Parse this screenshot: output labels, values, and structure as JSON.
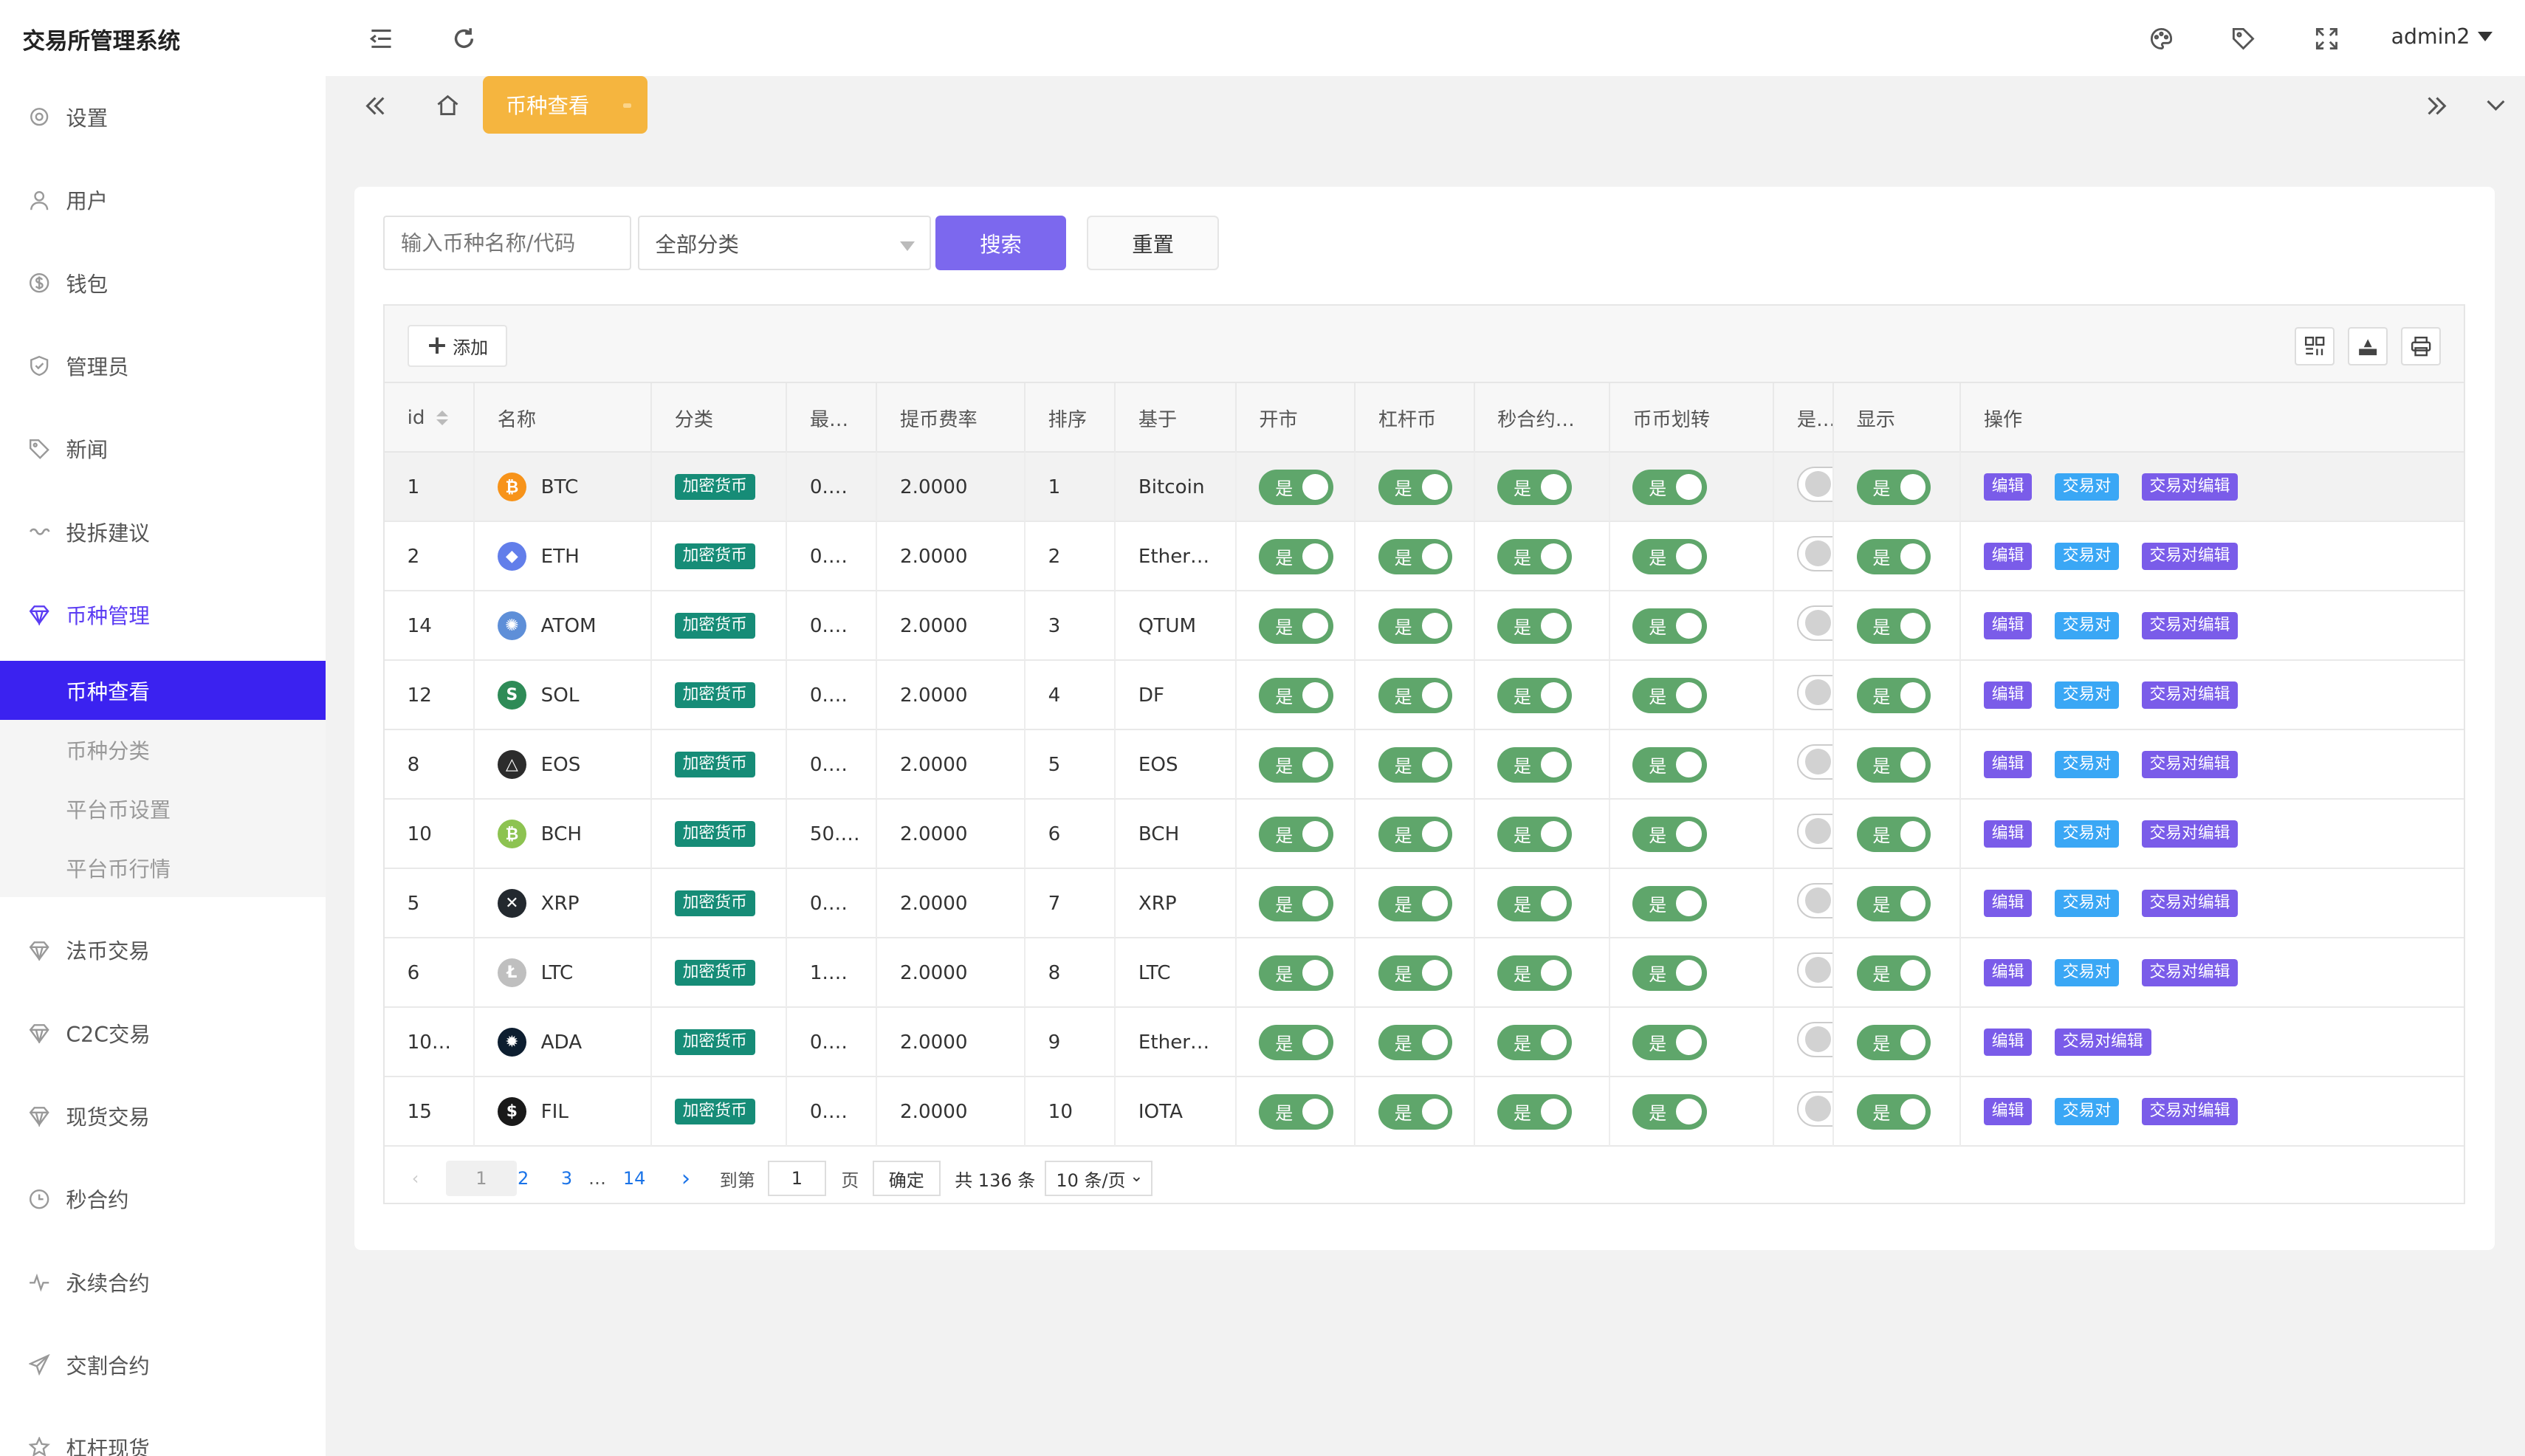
{
  "app": {
    "title": "交易所管理系统",
    "user": "admin2"
  },
  "sidebar": {
    "items": [
      {
        "label": "设置",
        "icon": "gear-icon"
      },
      {
        "label": "用户",
        "icon": "user-icon"
      },
      {
        "label": "钱包",
        "icon": "dollar-icon"
      },
      {
        "label": "管理员",
        "icon": "shield-icon"
      },
      {
        "label": "新闻",
        "icon": "tag-icon"
      },
      {
        "label": "投拆建议",
        "icon": "link-icon"
      },
      {
        "label": "币种管理",
        "icon": "diamond-icon"
      }
    ],
    "submenu": [
      "币种查看",
      "币种分类",
      "平台币设置",
      "平台币行情"
    ],
    "items2": [
      {
        "label": "法币交易",
        "icon": "diamond-icon"
      },
      {
        "label": "C2C交易",
        "icon": "diamond-icon"
      },
      {
        "label": "现货交易",
        "icon": "diamond-icon"
      },
      {
        "label": "秒合约",
        "icon": "clock-icon"
      },
      {
        "label": "永续合约",
        "icon": "pulse-icon"
      },
      {
        "label": "交割合约",
        "icon": "send-icon"
      },
      {
        "label": "杠杆现货",
        "icon": "star-icon"
      }
    ]
  },
  "tabs": {
    "active": "币种查看"
  },
  "search": {
    "placeholder": "输入币种名称/代码",
    "category": "全部分类",
    "search_label": "搜索",
    "reset_label": "重置"
  },
  "toolbar": {
    "add_label": "添加"
  },
  "table": {
    "headers": [
      "id",
      "名称",
      "分类",
      "最…",
      "提币费率",
      "排序",
      "基于",
      "开市",
      "杠杆币",
      "秒合约…",
      "币币划转",
      "是…",
      "显示",
      "操作"
    ],
    "rows": [
      {
        "id": "1",
        "name": "BTC",
        "cat": "加密货币",
        "min": "0.…",
        "fee": "2.0000",
        "sort": "1",
        "base": "Bitcoin",
        "hasPair": true,
        "coin_color": "#f7931a",
        "coin_glyph": "₿"
      },
      {
        "id": "2",
        "name": "ETH",
        "cat": "加密货币",
        "min": "0.…",
        "fee": "2.0000",
        "sort": "2",
        "base": "Ether…",
        "hasPair": true,
        "coin_color": "#627eea",
        "coin_glyph": "◆"
      },
      {
        "id": "14",
        "name": "ATOM",
        "cat": "加密货币",
        "min": "0.…",
        "fee": "2.0000",
        "sort": "3",
        "base": "QTUM",
        "hasPair": true,
        "coin_color": "#5e8fd8",
        "coin_glyph": "✺"
      },
      {
        "id": "12",
        "name": "SOL",
        "cat": "加密货币",
        "min": "0.…",
        "fee": "2.0000",
        "sort": "4",
        "base": "DF",
        "hasPair": true,
        "coin_color": "#2e8b57",
        "coin_glyph": "S"
      },
      {
        "id": "8",
        "name": "EOS",
        "cat": "加密货币",
        "min": "0.…",
        "fee": "2.0000",
        "sort": "5",
        "base": "EOS",
        "hasPair": true,
        "coin_color": "#2c2c2c",
        "coin_glyph": "△"
      },
      {
        "id": "10",
        "name": "BCH",
        "cat": "加密货币",
        "min": "50.…",
        "fee": "2.0000",
        "sort": "6",
        "base": "BCH",
        "hasPair": true,
        "coin_color": "#8dc351",
        "coin_glyph": "₿"
      },
      {
        "id": "5",
        "name": "XRP",
        "cat": "加密货币",
        "min": "0.…",
        "fee": "2.0000",
        "sort": "7",
        "base": "XRP",
        "hasPair": true,
        "coin_color": "#23292f",
        "coin_glyph": "✕"
      },
      {
        "id": "6",
        "name": "LTC",
        "cat": "加密货币",
        "min": "1.…",
        "fee": "2.0000",
        "sort": "8",
        "base": "LTC",
        "hasPair": true,
        "coin_color": "#bfbfbf",
        "coin_glyph": "Ł"
      },
      {
        "id": "10…",
        "name": "ADA",
        "cat": "加密货币",
        "min": "0.…",
        "fee": "2.0000",
        "sort": "9",
        "base": "Ether…",
        "hasPair": false,
        "coin_color": "#0d1e30",
        "coin_glyph": "✹"
      },
      {
        "id": "15",
        "name": "FIL",
        "cat": "加密货币",
        "min": "0.…",
        "fee": "2.0000",
        "sort": "10",
        "base": "IOTA",
        "hasPair": true,
        "coin_color": "#1a1a1a",
        "coin_glyph": "$"
      }
    ],
    "switch_on": "是",
    "ops": {
      "edit": "编辑",
      "pair": "交易对",
      "pair_edit": "交易对编辑"
    }
  },
  "pager": {
    "pages": [
      "1",
      "2",
      "3",
      "…",
      "14"
    ],
    "goto_label": "到第",
    "goto_value": "1",
    "page_unit": "页",
    "confirm": "确定",
    "total": "共 136 条",
    "per_page": "10 条/页"
  }
}
